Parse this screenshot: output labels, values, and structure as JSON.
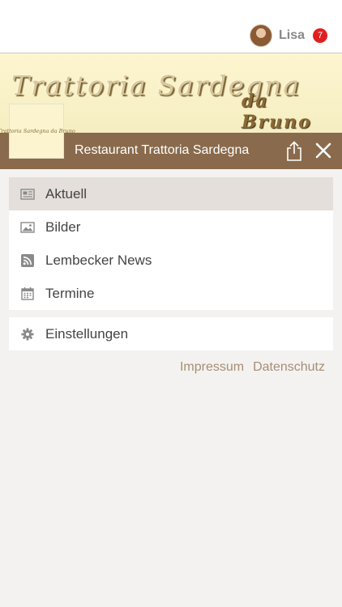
{
  "user": {
    "name": "Lisa",
    "notification_count": "7"
  },
  "banner": {
    "brand_line1": "Trattoria Sardegna",
    "brand_line2": "da Bruno",
    "thumb_text": "Trattoria Sardegna da Bruno"
  },
  "header": {
    "title": "Restaurant Trattoria Sardegna"
  },
  "menu": {
    "items": [
      {
        "label": "Aktuell",
        "icon": "newspaper-icon",
        "active": true
      },
      {
        "label": "Bilder",
        "icon": "image-icon"
      },
      {
        "label": "Lembecker News",
        "icon": "rss-icon"
      },
      {
        "label": "Termine",
        "icon": "calendar-icon"
      }
    ],
    "settings": {
      "label": "Einstellungen",
      "icon": "gear-icon"
    }
  },
  "footer": {
    "impressum": "Impressum",
    "datenschutz": "Datenschutz"
  },
  "colors": {
    "header_bg": "#8a6a4c",
    "link": "#a78e74",
    "badge": "#e02020",
    "active_row": "#e4dfda"
  }
}
